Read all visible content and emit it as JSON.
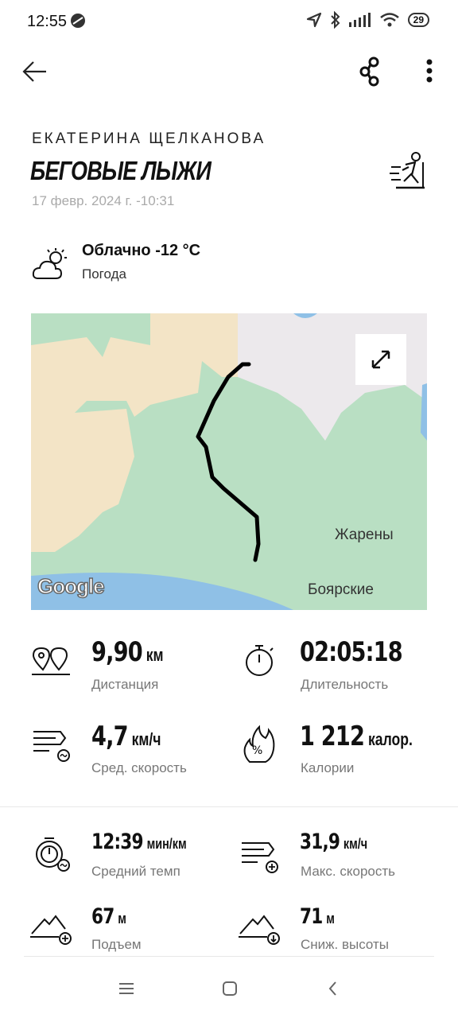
{
  "status_bar": {
    "time": "12:55",
    "battery": "29"
  },
  "header": {
    "user_name": "ЕКАТЕРИНА ЩЕЛКАНОВА",
    "activity": "БЕГОВЫЕ ЛЫЖИ",
    "date": "17 февр. 2024 г. -10:31"
  },
  "weather": {
    "title": "Облачно -12 °C",
    "subtitle": "Погода"
  },
  "map": {
    "labels": [
      "Жарены",
      "Боярские"
    ],
    "logo": "Google"
  },
  "stats": {
    "distance": {
      "value": "9,90",
      "unit": "км",
      "label": "Дистанция"
    },
    "duration": {
      "value": "02:05:18",
      "unit": "",
      "label": "Длительность"
    },
    "avg_speed": {
      "value": "4,7",
      "unit": "км/ч",
      "label": "Сред. скорость"
    },
    "calories": {
      "value": "1 212",
      "unit": "калор.",
      "label": "Калории"
    },
    "avg_pace": {
      "value": "12:39",
      "unit": "мин/км",
      "label": "Средний темп"
    },
    "max_speed": {
      "value": "31,9",
      "unit": "км/ч",
      "label": "Макс. скорость"
    },
    "ascent": {
      "value": "67",
      "unit": "м",
      "label": "Подъем"
    },
    "descent": {
      "value": "71",
      "unit": "м",
      "label": "Сниж. высоты"
    }
  }
}
